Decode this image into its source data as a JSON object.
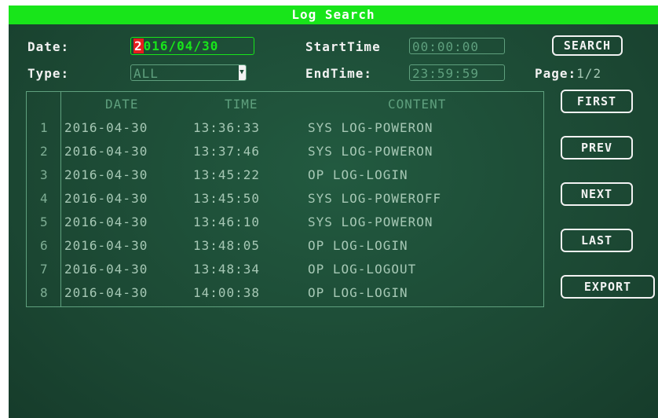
{
  "title": "Log Search",
  "form": {
    "date_label": "Date:",
    "date_cursor_char": "2",
    "date_rest": "016/04/30",
    "start_label": "StartTime",
    "start_value": "00:00:00",
    "type_label": "Type:",
    "type_value": "ALL",
    "end_label": "EndTime:",
    "end_value": "23:59:59",
    "page_label": "Page:",
    "page_value": "1/2"
  },
  "buttons": {
    "search": "SEARCH",
    "first": "FIRST",
    "prev": "PREV",
    "next": "NEXT",
    "last": "LAST",
    "export": "EXPORT"
  },
  "table": {
    "headers": {
      "date": "DATE",
      "time": "TIME",
      "content": "CONTENT"
    },
    "rows": [
      {
        "idx": "1",
        "date": "2016-04-30",
        "time": "13:36:33",
        "content": "SYS LOG-POWERON"
      },
      {
        "idx": "2",
        "date": "2016-04-30",
        "time": "13:37:46",
        "content": "SYS LOG-POWERON"
      },
      {
        "idx": "3",
        "date": "2016-04-30",
        "time": "13:45:22",
        "content": "OP LOG-LOGIN"
      },
      {
        "idx": "4",
        "date": "2016-04-30",
        "time": "13:45:50",
        "content": "SYS LOG-POWEROFF"
      },
      {
        "idx": "5",
        "date": "2016-04-30",
        "time": "13:46:10",
        "content": "SYS LOG-POWERON"
      },
      {
        "idx": "6",
        "date": "2016-04-30",
        "time": "13:48:05",
        "content": "OP LOG-LOGIN"
      },
      {
        "idx": "7",
        "date": "2016-04-30",
        "time": "13:48:34",
        "content": "OP LOG-LOGOUT"
      },
      {
        "idx": "8",
        "date": "2016-04-30",
        "time": "14:00:38",
        "content": "OP LOG-LOGIN"
      }
    ]
  },
  "colors": {
    "titlebar": "#18e51a",
    "background": "#1c4a35",
    "accent": "#18e51a",
    "cursor": "#e81d1d"
  }
}
